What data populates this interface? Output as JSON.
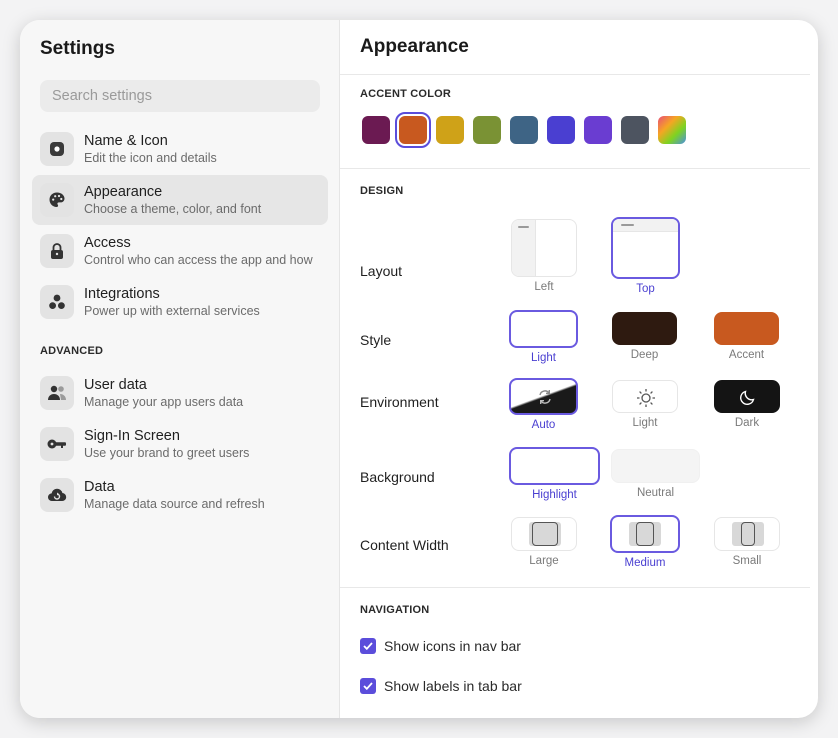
{
  "sidebar": {
    "title": "Settings",
    "search_placeholder": "Search settings",
    "items": [
      {
        "label": "Name & Icon",
        "sub": "Edit the icon and details"
      },
      {
        "label": "Appearance",
        "sub": "Choose a theme, color, and font"
      },
      {
        "label": "Access",
        "sub": "Control who can access the app and how"
      },
      {
        "label": "Integrations",
        "sub": "Power up with external services"
      }
    ],
    "advanced_label": "ADVANCED",
    "advanced_items": [
      {
        "label": "User data",
        "sub": "Manage your app users data"
      },
      {
        "label": "Sign-In Screen",
        "sub": "Use your brand to greet users"
      },
      {
        "label": "Data",
        "sub": "Manage data source and refresh"
      }
    ]
  },
  "main": {
    "title": "Appearance",
    "accent_label": "ACCENT COLOR",
    "accent_colors": [
      "#6b1a52",
      "#c8591f",
      "#cfa218",
      "#7a9234",
      "#3e6485",
      "#4a3fd1",
      "#6a3dd1",
      "#4d5460",
      "gradient"
    ],
    "selected_accent": "#c8591f",
    "design_label": "DESIGN",
    "layout": {
      "label": "Layout",
      "options": [
        "Left",
        "Top"
      ]
    },
    "style": {
      "label": "Style",
      "options": [
        "Light",
        "Deep",
        "Accent"
      ]
    },
    "environment": {
      "label": "Environment",
      "options": [
        "Auto",
        "Light",
        "Dark"
      ]
    },
    "background": {
      "label": "Background",
      "options": [
        "Highlight",
        "Neutral"
      ]
    },
    "content_width": {
      "label": "Content Width",
      "options": [
        "Large",
        "Medium",
        "Small"
      ]
    },
    "navigation_label": "NAVIGATION",
    "show_icons": "Show icons in nav bar",
    "show_labels": "Show labels in tab bar"
  }
}
